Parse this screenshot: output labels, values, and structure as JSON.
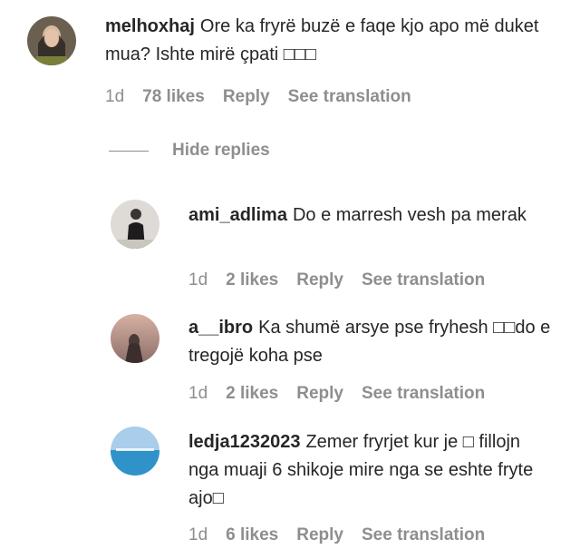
{
  "comments": [
    {
      "username": "melhoxhaj",
      "text": "Ore ka fryrë buzë e faqe kjo apo më duket mua? Ishte mirë çpati □□□",
      "time": "1d",
      "likes": "78 likes",
      "reply": "Reply",
      "translate": "See translation"
    }
  ],
  "hide_replies": "Hide replies",
  "replies": [
    {
      "username": "ami_adlima",
      "text": "Do e marresh vesh pa merak",
      "time": "1d",
      "likes": "2 likes",
      "reply": "Reply",
      "translate": "See translation"
    },
    {
      "username": "a__ibro",
      "text": "Ka shumë arsye pse fryhesh □□do e tregojë koha pse",
      "time": "1d",
      "likes": "2 likes",
      "reply": "Reply",
      "translate": "See translation"
    },
    {
      "username": "ledja1232023",
      "text": "Zemer fryrjet kur je □ fillojn nga muaji 6 shikoje mire nga se eshte fryte ajo□",
      "time": "1d",
      "likes": "6 likes",
      "reply": "Reply",
      "translate": "See translation"
    }
  ]
}
